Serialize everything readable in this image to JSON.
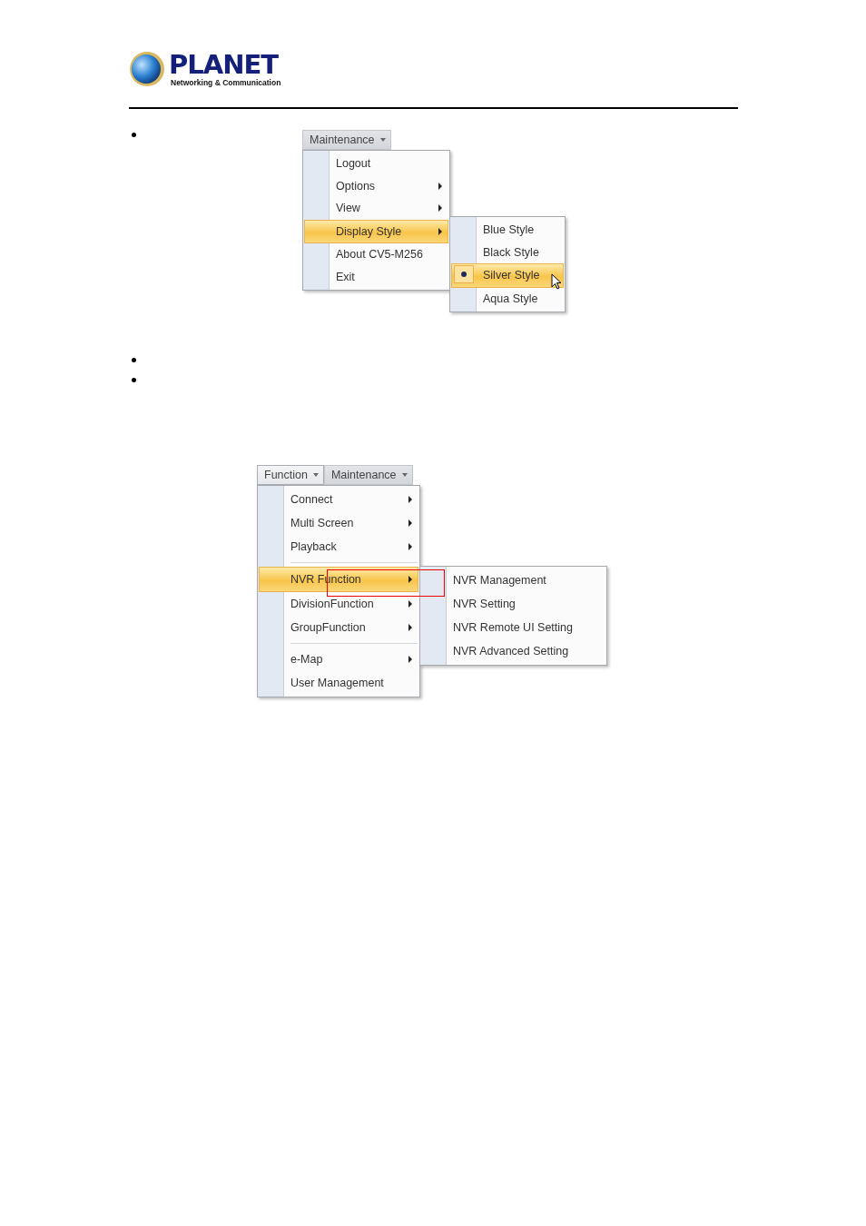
{
  "header": {
    "logo": {
      "name": "PLANET",
      "tagline": "Networking & Communication"
    }
  },
  "figures": [
    {
      "menubar": [
        {
          "label": "Maintenance",
          "selected": false
        }
      ],
      "menu": [
        {
          "kind": "item",
          "label": "Logout",
          "submenu": false,
          "selected": false
        },
        {
          "kind": "item",
          "label": "Options",
          "submenu": true,
          "selected": false
        },
        {
          "kind": "item",
          "label": "View",
          "submenu": true,
          "selected": false
        },
        {
          "kind": "item",
          "label": "Display Style",
          "submenu": true,
          "selected": true
        },
        {
          "kind": "item",
          "label": "About CV5-M256",
          "submenu": false,
          "selected": false
        },
        {
          "kind": "item",
          "label": "Exit",
          "submenu": false,
          "selected": false
        }
      ],
      "submenu": [
        {
          "label": "Blue Style",
          "selected": false,
          "checked": false
        },
        {
          "label": "Black Style",
          "selected": false,
          "checked": false
        },
        {
          "label": "Silver Style",
          "selected": true,
          "checked": true
        },
        {
          "label": "Aqua Style",
          "selected": false,
          "checked": false
        }
      ],
      "cursor": true,
      "highlight_frame": false
    },
    {
      "menubar": [
        {
          "label": "Function",
          "selected": true
        },
        {
          "label": "Maintenance",
          "selected": false
        }
      ],
      "menu": [
        {
          "kind": "item",
          "label": "Connect",
          "submenu": true,
          "selected": false
        },
        {
          "kind": "item",
          "label": "Multi Screen",
          "submenu": true,
          "selected": false
        },
        {
          "kind": "item",
          "label": "Playback",
          "submenu": true,
          "selected": false
        },
        {
          "kind": "separator"
        },
        {
          "kind": "item",
          "label": "NVR Function",
          "submenu": true,
          "selected": true
        },
        {
          "kind": "item",
          "label": "DivisionFunction",
          "submenu": true,
          "selected": false
        },
        {
          "kind": "item",
          "label": "GroupFunction",
          "submenu": true,
          "selected": false
        },
        {
          "kind": "separator"
        },
        {
          "kind": "item",
          "label": "e-Map",
          "submenu": true,
          "selected": false
        },
        {
          "kind": "item",
          "label": "User Management",
          "submenu": false,
          "selected": false
        }
      ],
      "submenu": [
        {
          "label": "NVR Management",
          "selected": false,
          "checked": false
        },
        {
          "label": "NVR Setting",
          "selected": false,
          "checked": false
        },
        {
          "label": "NVR Remote UI Setting",
          "selected": false,
          "checked": false
        },
        {
          "label": "NVR Advanced Setting",
          "selected": false,
          "checked": false
        }
      ],
      "cursor": false,
      "highlight_frame": true
    }
  ]
}
